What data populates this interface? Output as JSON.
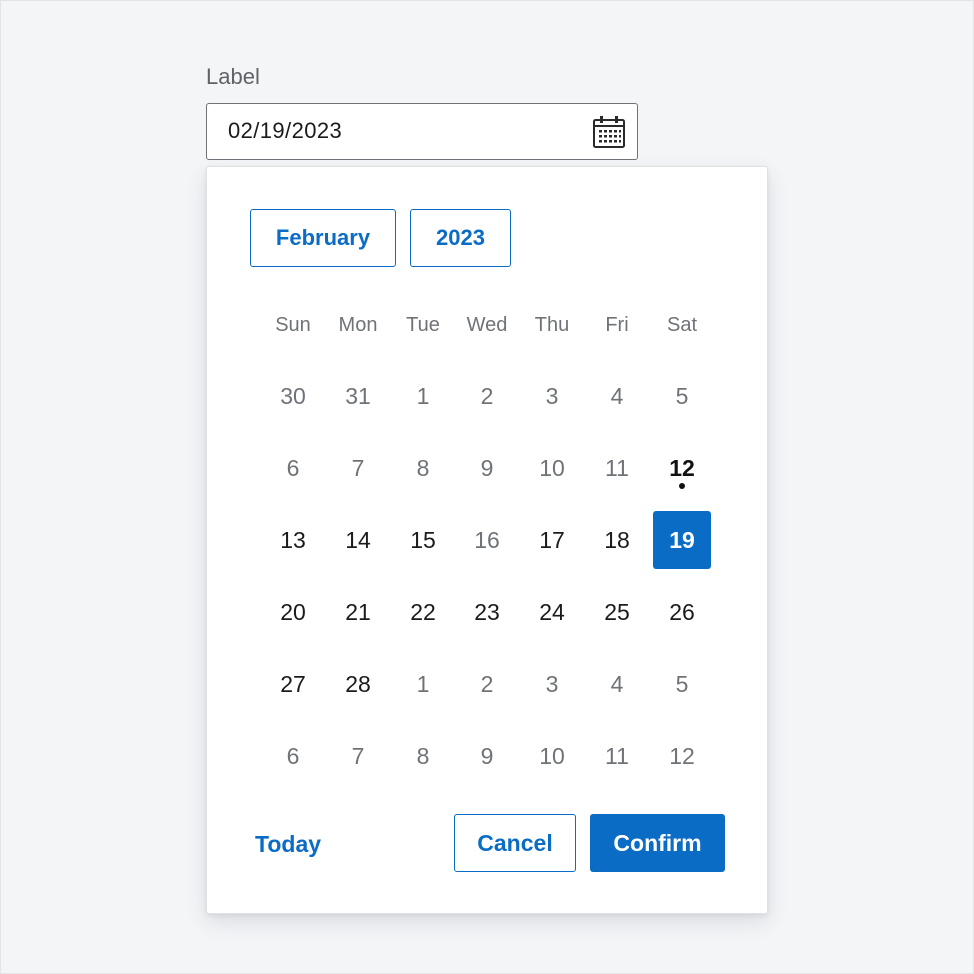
{
  "field": {
    "label": "Label",
    "value": "02/19/2023",
    "icon": "calendar-icon"
  },
  "picker": {
    "month_label": "February",
    "year_label": "2023",
    "weekdays": [
      "Sun",
      "Mon",
      "Tue",
      "Wed",
      "Thu",
      "Fri",
      "Sat"
    ],
    "weeks": [
      [
        {
          "label": "30",
          "state": "outside"
        },
        {
          "label": "31",
          "state": "outside"
        },
        {
          "label": "1",
          "state": "disabled"
        },
        {
          "label": "2",
          "state": "disabled"
        },
        {
          "label": "3",
          "state": "disabled"
        },
        {
          "label": "4",
          "state": "disabled"
        },
        {
          "label": "5",
          "state": "disabled"
        }
      ],
      [
        {
          "label": "6",
          "state": "disabled"
        },
        {
          "label": "7",
          "state": "disabled"
        },
        {
          "label": "8",
          "state": "disabled"
        },
        {
          "label": "9",
          "state": "disabled"
        },
        {
          "label": "10",
          "state": "disabled"
        },
        {
          "label": "11",
          "state": "disabled"
        },
        {
          "label": "12",
          "state": "today"
        }
      ],
      [
        {
          "label": "13",
          "state": "enabled"
        },
        {
          "label": "14",
          "state": "enabled"
        },
        {
          "label": "15",
          "state": "enabled"
        },
        {
          "label": "16",
          "state": "disabled"
        },
        {
          "label": "17",
          "state": "enabled"
        },
        {
          "label": "18",
          "state": "enabled"
        },
        {
          "label": "19",
          "state": "selected"
        }
      ],
      [
        {
          "label": "20",
          "state": "enabled"
        },
        {
          "label": "21",
          "state": "enabled"
        },
        {
          "label": "22",
          "state": "enabled"
        },
        {
          "label": "23",
          "state": "enabled"
        },
        {
          "label": "24",
          "state": "enabled"
        },
        {
          "label": "25",
          "state": "enabled"
        },
        {
          "label": "26",
          "state": "enabled"
        }
      ],
      [
        {
          "label": "27",
          "state": "enabled"
        },
        {
          "label": "28",
          "state": "enabled"
        },
        {
          "label": "1",
          "state": "outside"
        },
        {
          "label": "2",
          "state": "outside"
        },
        {
          "label": "3",
          "state": "outside"
        },
        {
          "label": "4",
          "state": "outside"
        },
        {
          "label": "5",
          "state": "outside"
        }
      ],
      [
        {
          "label": "6",
          "state": "outside"
        },
        {
          "label": "7",
          "state": "outside"
        },
        {
          "label": "8",
          "state": "outside"
        },
        {
          "label": "9",
          "state": "outside"
        },
        {
          "label": "10",
          "state": "outside"
        },
        {
          "label": "11",
          "state": "outside"
        },
        {
          "label": "12",
          "state": "outside"
        }
      ]
    ],
    "today_label": "Today",
    "cancel_label": "Cancel",
    "confirm_label": "Confirm"
  },
  "colors": {
    "accent": "#0b6cc6",
    "background": "#f4f5f7",
    "text": "#1b1b1b",
    "muted_text": "#6f7378"
  }
}
